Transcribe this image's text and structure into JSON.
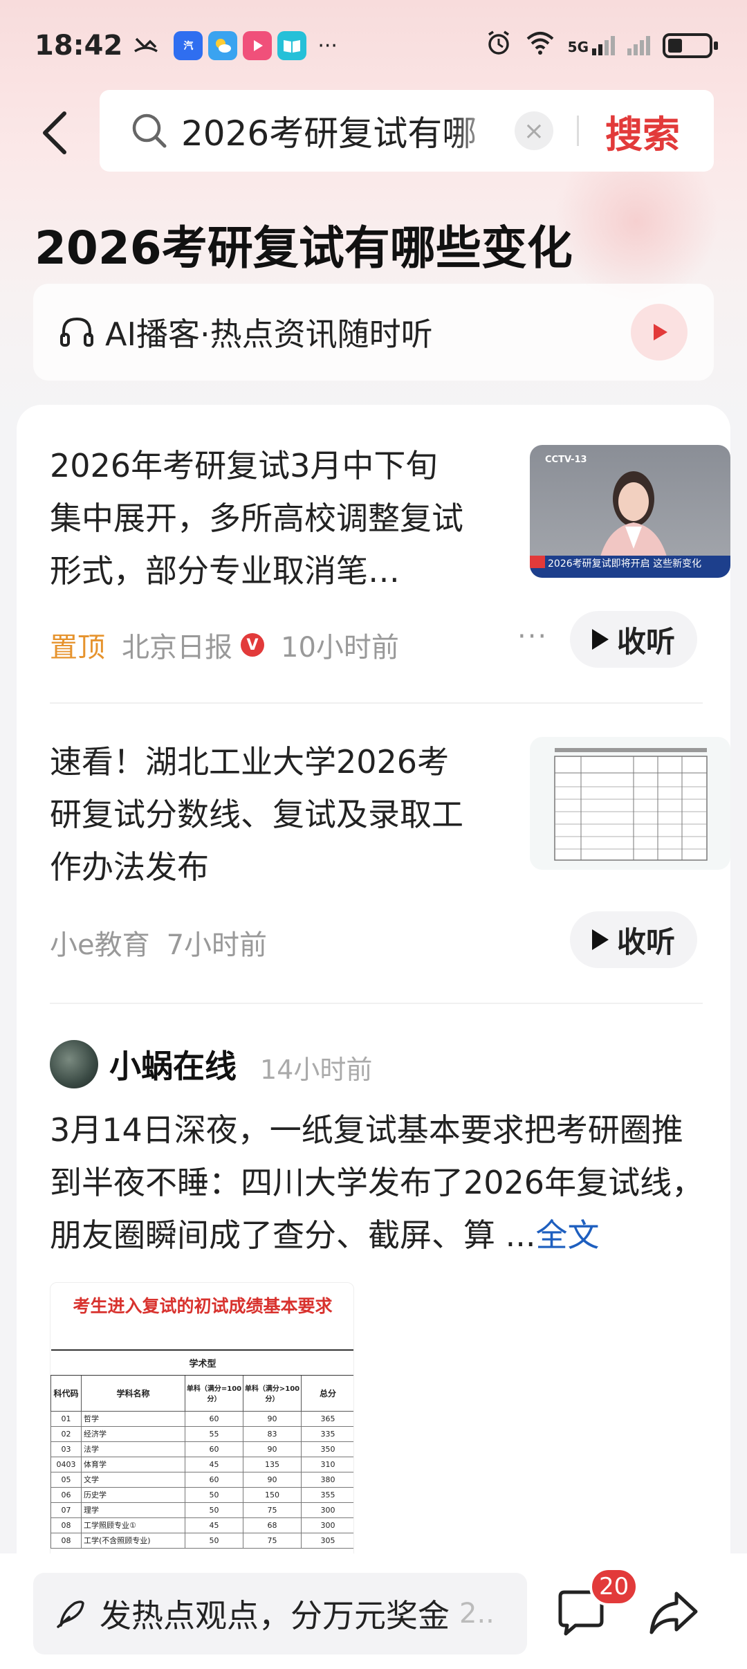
{
  "status_bar": {
    "time": "18:42",
    "network": "5G",
    "app_icons": [
      "app-icon-car",
      "app-icon-weather",
      "app-icon-video",
      "app-icon-book"
    ],
    "more": "···"
  },
  "search": {
    "query": "2026考研复试有哪",
    "button_label": "搜索",
    "clear_symbol": "×"
  },
  "page": {
    "title": "2026考研复试有哪些变化"
  },
  "podcast": {
    "label": "AI播客·热点资讯随时听"
  },
  "news": [
    {
      "title": "2026年考研复试3月中下旬集中展开，多所高校调整复试形式，部分专业取消笔…",
      "pinned_label": "置顶",
      "source": "北京日报",
      "verified": "V",
      "time": "10小时前",
      "more": "···",
      "listen_label": "收听",
      "thumb_caption": "2026考研复试即将开启 这些新变化",
      "thumb_logo": "CCTV-13"
    },
    {
      "title": "速看！湖北工业大学2026考研复试分数线、复试及录取工作办法发布",
      "source": "小e教育",
      "time": "7小时前",
      "listen_label": "收听"
    }
  ],
  "post": {
    "author": "小蜗在线",
    "time": "14小时前",
    "text": "3月14日深夜，一纸复试基本要求把考研圈推到半夜不睡：四川大学发布了2026年复试线，朋友圈瞬间成了查分、截屏、算 ...",
    "full_link": "全文",
    "image": {
      "heading": "考生进入复试的初试成绩基本要求",
      "table_title": "学术型",
      "columns": [
        "科代码",
        "学科名称",
        "单科（满分=100分）",
        "单科（满分>100分）",
        "总分"
      ],
      "rows": [
        [
          "01",
          "哲学",
          "60",
          "90",
          "365"
        ],
        [
          "02",
          "经济学",
          "55",
          "83",
          "335"
        ],
        [
          "03",
          "法学",
          "60",
          "90",
          "350"
        ],
        [
          "0403",
          "体育学",
          "45",
          "135",
          "310"
        ],
        [
          "05",
          "文学",
          "60",
          "90",
          "380"
        ],
        [
          "06",
          "历史学",
          "50",
          "150",
          "355"
        ],
        [
          "07",
          "理学",
          "50",
          "75",
          "300"
        ],
        [
          "08",
          "工学照顾专业①",
          "45",
          "68",
          "300"
        ],
        [
          "08",
          "工学(不含照顾专业)",
          "50",
          "75",
          "305"
        ]
      ]
    }
  },
  "bottom_bar": {
    "input_placeholder": "发热点观点，分万元奖金",
    "input_more": "2..",
    "badge_count": "20"
  },
  "colors": {
    "accent_red": "#e23a3a",
    "pin_orange": "#e6932d",
    "link_blue": "#1e5fbf"
  }
}
